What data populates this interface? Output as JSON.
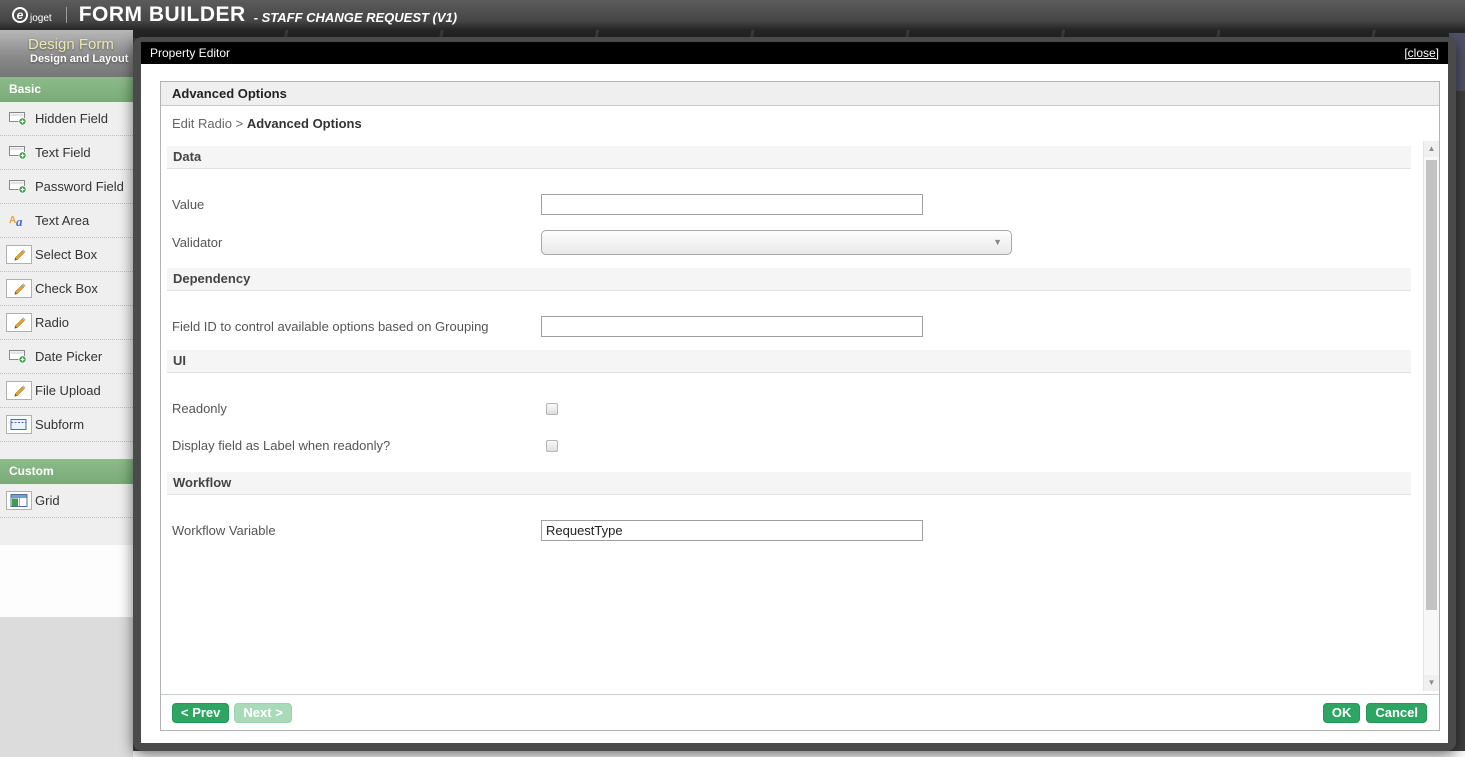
{
  "topbar": {
    "logo_text": "joget",
    "logo_glyph": "e",
    "title": "FORM BUILDER",
    "subtitle": "- STAFF CHANGE REQUEST (V1)"
  },
  "sidebar": {
    "title": "Design Form",
    "subtitle": "Design and Layout",
    "sections": [
      {
        "label": "Basic",
        "items": [
          {
            "label": "Hidden Field",
            "icon": "textbox-add-icon"
          },
          {
            "label": "Text Field",
            "icon": "textbox-add-icon"
          },
          {
            "label": "Password Field",
            "icon": "textbox-add-icon"
          },
          {
            "label": "Text Area",
            "icon": "textarea-icon"
          },
          {
            "label": "Select Box",
            "icon": "pencil-icon"
          },
          {
            "label": "Check Box",
            "icon": "pencil-icon"
          },
          {
            "label": "Radio",
            "icon": "pencil-icon"
          },
          {
            "label": "Date Picker",
            "icon": "textbox-add-icon"
          },
          {
            "label": "File Upload",
            "icon": "pencil-icon"
          },
          {
            "label": "Subform",
            "icon": "subform-icon"
          }
        ]
      },
      {
        "label": "Custom",
        "items": [
          {
            "label": "Grid",
            "icon": "grid-icon"
          }
        ]
      }
    ]
  },
  "modal": {
    "title": "Property Editor",
    "close_label": "[close]",
    "heading": "Advanced Options",
    "breadcrumb": {
      "parent": "Edit Radio",
      "separator": ">",
      "current": "Advanced Options"
    },
    "sections": [
      {
        "label": "Data",
        "fields": [
          {
            "label": "Value",
            "type": "text",
            "value": ""
          },
          {
            "label": "Validator",
            "type": "select",
            "value": ""
          }
        ]
      },
      {
        "label": "Dependency",
        "fields": [
          {
            "label": "Field ID to control available options based on Grouping",
            "type": "text",
            "value": ""
          }
        ]
      },
      {
        "label": "UI",
        "fields": [
          {
            "label": "Readonly",
            "type": "checkbox",
            "checked": false
          },
          {
            "label": "Display field as Label when readonly?",
            "type": "checkbox",
            "checked": false
          }
        ]
      },
      {
        "label": "Workflow",
        "fields": [
          {
            "label": "Workflow Variable",
            "type": "text",
            "value": "RequestType"
          }
        ]
      }
    ],
    "buttons": {
      "prev": "< Prev",
      "next": "Next >",
      "ok": "OK",
      "cancel": "Cancel"
    }
  },
  "icons": {
    "scroll_up": "▲",
    "scroll_down": "▼",
    "dropdown": "▼"
  },
  "colors": {
    "accent_green": "#2fa563",
    "disabled_green": "#a9dbb9",
    "palette_header_green": "#7fb27d",
    "modal_titlebar": "#000000",
    "overlay": "#3f3f3f",
    "topbar": "#4a4a4a"
  }
}
